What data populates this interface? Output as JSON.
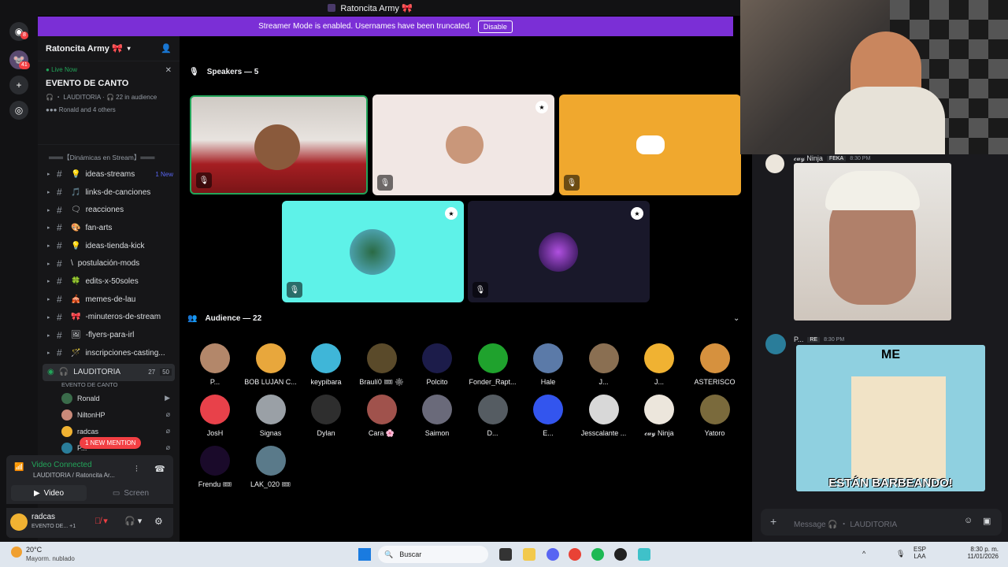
{
  "window": {
    "title": "Ratoncita Army 🎀"
  },
  "banner": {
    "text": "Streamer Mode is enabled. Usernames have been truncated.",
    "button": "Disable"
  },
  "rail": {
    "badge_home": "8",
    "badge_server": "41"
  },
  "server": {
    "name": "Ratoncita Army 🎀"
  },
  "live": {
    "label": "Live Now",
    "event": "EVENTO DE CANTO",
    "channel": "LAUDITORIA",
    "audience": "22 in audience",
    "people": "Ronald and 4 others"
  },
  "category": "═══【Dinámicas en Stream】═══",
  "channels": [
    {
      "label": "ideas-streams",
      "emoji": "💡",
      "new": "1 New"
    },
    {
      "label": "links-de-canciones",
      "emoji": "🎵",
      "new": ""
    },
    {
      "label": "reacciones",
      "emoji": "🗨",
      "new": ""
    },
    {
      "label": "fan-arts",
      "emoji": "🎨",
      "new": ""
    },
    {
      "label": "ideas-tienda-kick",
      "emoji": "💡",
      "new": ""
    },
    {
      "label": "postulación-mods",
      "emoji": "\\",
      "new": ""
    },
    {
      "label": "edits-x-50soles",
      "emoji": "🍀",
      "new": ""
    },
    {
      "label": "memes-de-lau",
      "emoji": "🎪",
      "new": ""
    },
    {
      "label": "-minuteros-de-stream",
      "emoji": "🎀",
      "new": ""
    },
    {
      "label": "-flyers-para-irl",
      "emoji": "🖼",
      "new": ""
    },
    {
      "label": "inscripciones-casting...",
      "emoji": "🪄",
      "new": ""
    }
  ],
  "voice_channel": {
    "label": "LAUDITORIA",
    "sub": "EVENTO DE CANTO",
    "count_a": "27",
    "count_b": "50"
  },
  "voice_users": [
    {
      "name": "Ronald",
      "color": "#3a6b4a"
    },
    {
      "name": "NiltonHP",
      "color": "#c98a7a"
    },
    {
      "name": "radcas",
      "color": "#f0b232"
    },
    {
      "name": "P...",
      "tag": "RE",
      "color": "#2a7d9a"
    },
    {
      "name": "",
      "color": "#444"
    }
  ],
  "mention": "1 NEW MENTION",
  "voice_connection": {
    "status": "Video Connected",
    "where": "LAUDITORIA / Ratoncita Ar...",
    "video": "Video",
    "screen": "Screen"
  },
  "user": {
    "name": "radcas",
    "status": "EVENTO DE...",
    "extra": "+1"
  },
  "speakers": {
    "header": "Speakers — 5"
  },
  "audience": {
    "header": "Audience — 22",
    "members": [
      {
        "name": "P...",
        "color": "#b3876a"
      },
      {
        "name": "BOB LUJAN C...",
        "color": "#e8a73c"
      },
      {
        "name": "keypibara",
        "color": "#3fb6d8"
      },
      {
        "name": "Braulí0 🎟 ⚙",
        "color": "#5a4a2a"
      },
      {
        "name": "Polcito",
        "color": "#1c1c4a"
      },
      {
        "name": "Fonder_Rapt...",
        "color": "#1fa22d"
      },
      {
        "name": "Hale",
        "color": "#5b7aa8"
      },
      {
        "name": "J...",
        "color": "#8a6f52"
      },
      {
        "name": "J...",
        "color": "#f0b232"
      },
      {
        "name": "ASTERISCO",
        "color": "#d6913e"
      },
      {
        "name": "JosH",
        "color": "#e8414a"
      },
      {
        "name": "Signas",
        "color": "#9aa0a6"
      },
      {
        "name": "Dylan",
        "color": "#2e2e2e"
      },
      {
        "name": "Cara 🌸",
        "color": "#a0524c"
      },
      {
        "name": "Saimon",
        "color": "#6a6a7a"
      },
      {
        "name": "D...",
        "color": "#555c62"
      },
      {
        "name": "E...",
        "color": "#3355ee"
      },
      {
        "name": "Jesscalante ...",
        "color": "#d8d8d8"
      },
      {
        "name": "𝒸𝓊𝓎 Ninja",
        "color": "#ece6dc"
      },
      {
        "name": "Yatoro",
        "color": "#7a6a3c"
      },
      {
        "name": "Frendu 🎟",
        "color": "#1a0a2a"
      },
      {
        "name": "LAK_020 🎟",
        "color": "#5a7a8a"
      }
    ]
  },
  "chat": {
    "msg1": {
      "author": "𝒸𝓊𝓎 Ninja",
      "tag": "FEKA",
      "time": "8:30 PM"
    },
    "msg2": {
      "author": "P...",
      "tag": "RE",
      "time": "8:30 PM"
    },
    "meme_top": "ME",
    "meme_bottom": "ESTÁN BARBEANDO!",
    "placeholder": "Message 🎧 ・ LAUDITORIA"
  },
  "taskbar": {
    "temp": "20°C",
    "weather": "Mayorm. nublado",
    "search": "Buscar",
    "lang": "ESP",
    "lang2": "LAA",
    "time": "8:30 p. m.",
    "date": "11/01/2026"
  },
  "colors": {
    "accent": "#5865f2",
    "banner": "#7b2fd6",
    "green": "#23a55a"
  }
}
